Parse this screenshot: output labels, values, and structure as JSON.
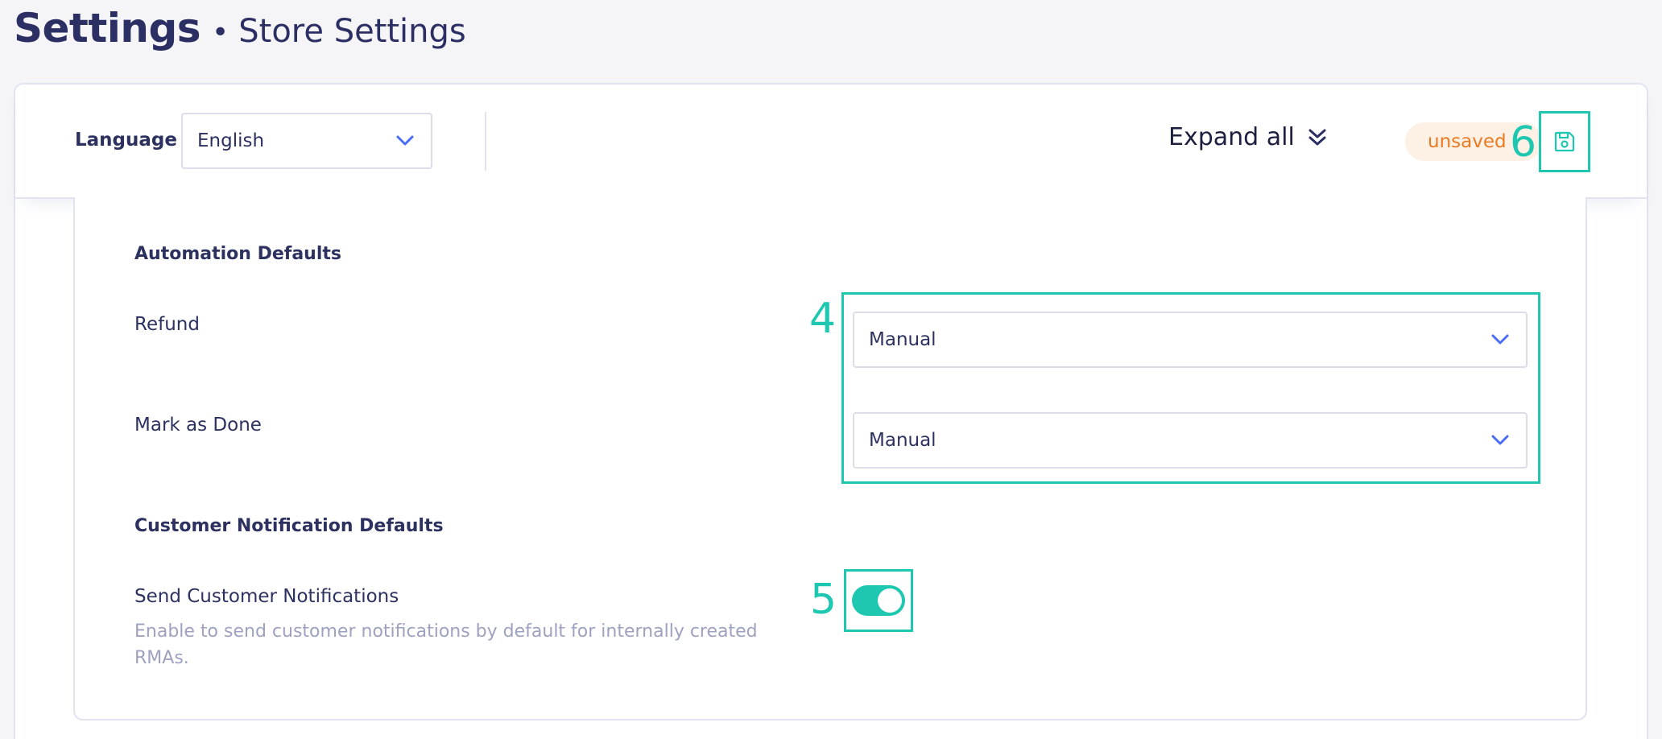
{
  "header": {
    "title": "Settings",
    "separator": "•",
    "subtitle": "Store Settings"
  },
  "toolbar": {
    "language_label": "Language",
    "language_value": "English",
    "expand_all_label": "Expand all",
    "unsaved_badge": "unsaved",
    "save_icon": "floppy-disk-icon"
  },
  "annotations": {
    "marker_4": "4",
    "marker_5": "5",
    "marker_6": "6"
  },
  "automation": {
    "section_title": "Automation Defaults",
    "refund_label": "Refund",
    "refund_value": "Manual",
    "mark_done_label": "Mark as Done",
    "mark_done_value": "Manual"
  },
  "notifications": {
    "section_title": "Customer Notification Defaults",
    "send_label": "Send Customer Notifications",
    "send_help": "Enable to send customer notifications by default for internally created RMAs.",
    "send_enabled": true
  },
  "colors": {
    "accent": "#1ec7b0",
    "title": "#2b2f63",
    "unsaved_text": "#ea7b22",
    "unsaved_bg": "#fdf0e4",
    "chevron": "#4a6cf7"
  }
}
